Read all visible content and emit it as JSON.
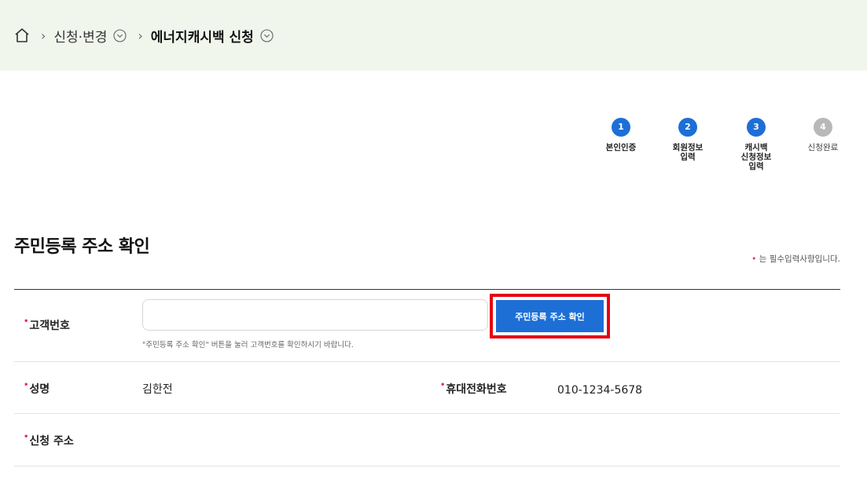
{
  "breadcrumb": {
    "item1": "신청·변경",
    "item2": "에너지캐시백 신청"
  },
  "steps": [
    {
      "num": "1",
      "label": "본인인증"
    },
    {
      "num": "2",
      "label": "회원정보\n입력"
    },
    {
      "num": "3",
      "label": "캐시백\n신청정보\n입력"
    },
    {
      "num": "4",
      "label": "신청완료"
    }
  ],
  "section": {
    "title": "주민등록 주소 확인",
    "required_note": "는 필수입력사항입니다.",
    "required_mark": "•"
  },
  "form": {
    "customer_number_label": "고객번호",
    "customer_number_value": "",
    "check_button": "주민등록 주소 확인",
    "hint": "\"주민등록 주소 확인\" 버튼을 눌러 고객번호를 확인하시기 바랍니다.",
    "name_label": "성명",
    "name_value": "김한전",
    "phone_label": "휴대전화번호",
    "phone_value": "010-1234-5678",
    "address_label": "신청 주소"
  },
  "colors": {
    "accent": "#1d6fd6",
    "highlight": "#e60012",
    "breadcrumb_bg": "#f1f6ec",
    "required": "#e0315b"
  }
}
